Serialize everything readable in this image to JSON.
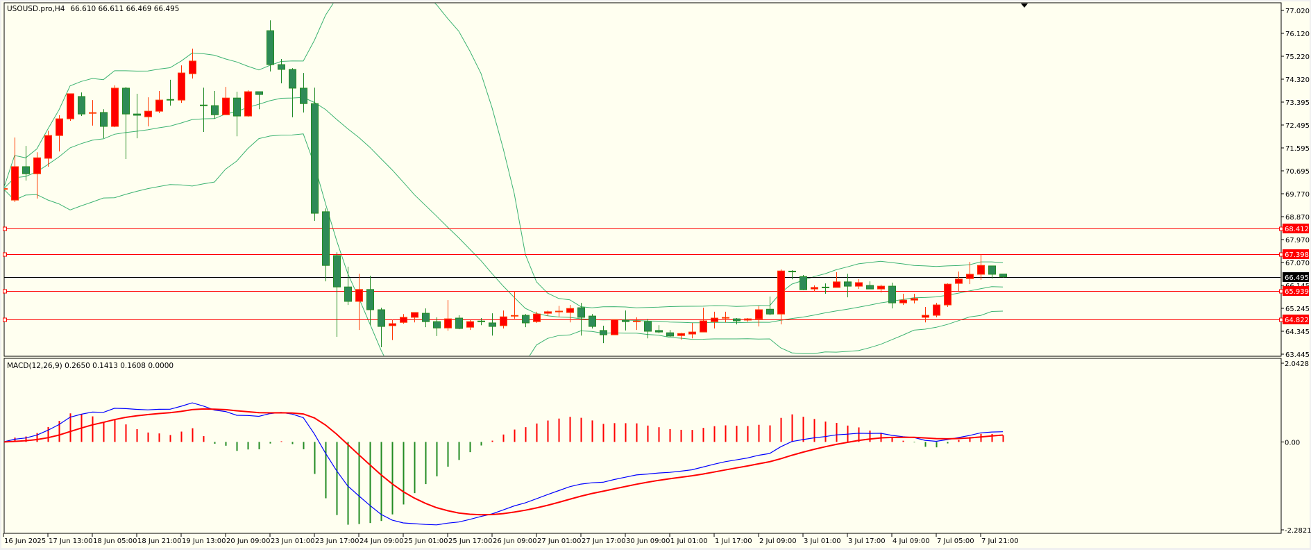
{
  "header": {
    "symbol": "USOUSD.pro,H4",
    "ohlc": "66.610 66.611 66.469 66.495"
  },
  "indicator": {
    "label": "MACD(12,26,9) 0.2650 0.1413 0.1608 0.0000"
  },
  "colors": {
    "background": "#fffff0",
    "bull": "#ff0000",
    "bull_border": "#ff3a00",
    "bear": "#2e8b57",
    "bear_border": "#228b22",
    "bands": "#3cb371",
    "level": "#ff0000",
    "macd_main": "#0000ff",
    "macd_signal": "#ff0000"
  },
  "chart_data": [
    {
      "type": "candlestick",
      "title": "USOUSD.pro,H4",
      "ylim": [
        63.445,
        77.02
      ],
      "y_ticks": [
        "77.020",
        "76.120",
        "75.220",
        "74.320",
        "73.395",
        "72.495",
        "71.595",
        "70.695",
        "69.770",
        "68.870",
        "67.970",
        "67.070",
        "66.145",
        "65.245",
        "64.345",
        "63.445"
      ],
      "x_labels": [
        "16 Jun 2025",
        "17 Jun 13:00",
        "18 Jun 05:00",
        "18 Jun 21:00",
        "19 Jun 13:00",
        "20 Jun 09:00",
        "23 Jun 01:00",
        "23 Jun 17:00",
        "24 Jun 09:00",
        "25 Jun 01:00",
        "25 Jun 17:00",
        "26 Jun 09:00",
        "27 Jun 01:00",
        "27 Jun 17:00",
        "30 Jun 09:00",
        "1 Jul 01:00",
        "1 Jul 17:00",
        "2 Jul 09:00",
        "3 Jul 01:00",
        "3 Jul 17:00",
        "4 Jul 09:00",
        "7 Jul 05:00",
        "7 Jul 21:00"
      ],
      "x_label_every": 4,
      "levels": [
        {
          "value": 68.412,
          "label": "68.412",
          "color": "#ff0000"
        },
        {
          "value": 67.398,
          "label": "67.398",
          "color": "#ff0000"
        },
        {
          "value": 65.939,
          "label": "65.939",
          "color": "#ff0000"
        },
        {
          "value": 64.822,
          "label": "64.822",
          "color": "#ff0000"
        },
        {
          "value": 66.495,
          "label": "66.495",
          "color": "#000000"
        }
      ],
      "bollinger": {
        "period": 20,
        "deviation": 2
      },
      "candles": [
        [
          69.97,
          70.38,
          69.67,
          69.97
        ],
        [
          69.53,
          72.0,
          69.45,
          70.85
        ],
        [
          70.85,
          71.67,
          70.3,
          70.57
        ],
        [
          70.57,
          71.42,
          69.59,
          71.2
        ],
        [
          71.18,
          72.27,
          70.85,
          72.08
        ],
        [
          72.08,
          72.88,
          71.45,
          72.74
        ],
        [
          72.74,
          73.73,
          72.66,
          73.73
        ],
        [
          73.62,
          73.78,
          72.85,
          72.93
        ],
        [
          72.95,
          73.48,
          72.47,
          72.97
        ],
        [
          72.99,
          73.12,
          71.97,
          72.44
        ],
        [
          72.44,
          74.06,
          72.41,
          73.95
        ],
        [
          73.95,
          74.0,
          71.15,
          72.93
        ],
        [
          72.93,
          73.73,
          71.97,
          72.88
        ],
        [
          72.82,
          73.59,
          72.44,
          73.04
        ],
        [
          73.04,
          73.84,
          72.96,
          73.48
        ],
        [
          73.49,
          74.28,
          73.26,
          73.47
        ],
        [
          73.48,
          74.85,
          73.37,
          74.55
        ],
        [
          74.52,
          75.51,
          74.33,
          75.02
        ],
        [
          73.27,
          73.97,
          72.22,
          73.25
        ],
        [
          73.26,
          73.84,
          72.74,
          72.9
        ],
        [
          72.9,
          74.0,
          72.9,
          73.56
        ],
        [
          73.56,
          73.81,
          72.05,
          72.85
        ],
        [
          72.85,
          73.87,
          72.82,
          73.81
        ],
        [
          73.81,
          73.81,
          73.12,
          73.7
        ],
        [
          76.22,
          76.63,
          74.61,
          74.88
        ],
        [
          74.88,
          75.1,
          74.14,
          74.69
        ],
        [
          74.69,
          74.74,
          72.8,
          73.95
        ],
        [
          73.95,
          74.55,
          72.99,
          73.34
        ],
        [
          73.34,
          73.97,
          68.71,
          69.01
        ],
        [
          69.07,
          69.2,
          66.32,
          66.95
        ],
        [
          67.34,
          67.47,
          64.13,
          66.1
        ],
        [
          66.1,
          66.9,
          65.39,
          65.53
        ],
        [
          65.53,
          66.62,
          64.4,
          66.0
        ],
        [
          66.0,
          66.54,
          64.59,
          65.2
        ],
        [
          65.2,
          65.28,
          63.72,
          64.54
        ],
        [
          64.57,
          64.81,
          64.0,
          64.65
        ],
        [
          64.7,
          65.03,
          64.65,
          64.9
        ],
        [
          64.9,
          65.09,
          64.7,
          65.09
        ],
        [
          65.06,
          65.25,
          64.51,
          64.73
        ],
        [
          64.73,
          64.9,
          64.16,
          64.48
        ],
        [
          64.48,
          65.58,
          64.37,
          64.84
        ],
        [
          64.87,
          64.98,
          64.43,
          64.46
        ],
        [
          64.51,
          64.79,
          64.4,
          64.73
        ],
        [
          64.74,
          64.87,
          64.59,
          64.72
        ],
        [
          64.68,
          65.06,
          64.18,
          64.54
        ],
        [
          64.57,
          65.17,
          64.46,
          64.92
        ],
        [
          64.94,
          65.94,
          64.84,
          64.96
        ],
        [
          64.98,
          65.03,
          64.51,
          64.68
        ],
        [
          64.73,
          65.12,
          64.68,
          65.03
        ],
        [
          65.06,
          65.17,
          64.95,
          65.12
        ],
        [
          65.11,
          65.35,
          64.92,
          65.13
        ],
        [
          65.09,
          65.39,
          64.7,
          65.25
        ],
        [
          65.28,
          65.47,
          64.18,
          64.9
        ],
        [
          64.95,
          65.03,
          64.46,
          64.54
        ],
        [
          64.38,
          64.57,
          63.88,
          64.21
        ],
        [
          64.21,
          64.81,
          64.21,
          64.81
        ],
        [
          64.79,
          65.17,
          64.38,
          64.73
        ],
        [
          64.72,
          64.9,
          64.4,
          64.74
        ],
        [
          64.73,
          64.84,
          64.07,
          64.35
        ],
        [
          64.38,
          64.59,
          64.27,
          64.32
        ],
        [
          64.29,
          64.4,
          64.13,
          64.16
        ],
        [
          64.18,
          64.29,
          64.02,
          64.26
        ],
        [
          64.24,
          64.68,
          64.07,
          64.32
        ],
        [
          64.32,
          65.28,
          64.32,
          64.76
        ],
        [
          64.73,
          65.12,
          64.46,
          64.87
        ],
        [
          64.86,
          65.12,
          64.7,
          64.88
        ],
        [
          64.84,
          64.87,
          64.62,
          64.76
        ],
        [
          64.79,
          64.87,
          64.73,
          64.84
        ],
        [
          64.84,
          65.34,
          64.54,
          65.2
        ],
        [
          65.22,
          65.72,
          64.98,
          65.03
        ],
        [
          65.03,
          66.79,
          64.62,
          66.73
        ],
        [
          66.71,
          66.76,
          66.4,
          66.68
        ],
        [
          66.51,
          66.57,
          65.97,
          65.99
        ],
        [
          66.02,
          66.16,
          65.91,
          66.08
        ],
        [
          66.08,
          66.24,
          65.83,
          66.05
        ],
        [
          66.08,
          66.68,
          66.08,
          66.3
        ],
        [
          66.3,
          66.62,
          65.69,
          66.13
        ],
        [
          66.13,
          66.41,
          66.02,
          66.27
        ],
        [
          66.16,
          66.32,
          66.02,
          66.02
        ],
        [
          66.02,
          66.19,
          65.88,
          66.13
        ],
        [
          66.13,
          66.27,
          65.25,
          65.47
        ],
        [
          65.47,
          65.83,
          65.39,
          65.58
        ],
        [
          65.58,
          65.83,
          65.45,
          65.64
        ],
        [
          64.9,
          65.31,
          64.7,
          64.98
        ],
        [
          64.98,
          65.47,
          64.9,
          65.39
        ],
        [
          65.39,
          66.24,
          65.31,
          66.21
        ],
        [
          66.24,
          66.71,
          65.94,
          66.41
        ],
        [
          66.43,
          67.09,
          66.21,
          66.6
        ],
        [
          66.6,
          67.39,
          66.38,
          66.95
        ],
        [
          66.93,
          66.93,
          66.43,
          66.6
        ],
        [
          66.61,
          66.61,
          66.47,
          66.5
        ]
      ]
    },
    {
      "type": "line",
      "title": "MACD(12,26,9)",
      "ylim": [
        -2.2821,
        2.0428
      ],
      "y_ticks": [
        "2.0428",
        "0.00",
        "-2.2821"
      ],
      "params": {
        "fast": 12,
        "slow": 26,
        "signal": 9
      },
      "values": {
        "main": 0.265,
        "signal": 0.1413,
        "v3": 0.1608,
        "v4": 0.0
      }
    }
  ]
}
